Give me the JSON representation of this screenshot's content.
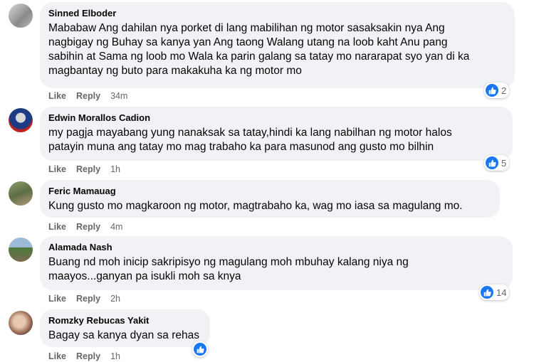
{
  "actions": {
    "like": "Like",
    "reply": "Reply"
  },
  "comments": [
    {
      "author": "Sinned Elboder",
      "lines": [
        "Mababaw Ang dahilan nya porket di lang mabilihan ng motor sasaksakin nya Ang",
        "nagbigay ng Buhay sa kanya yan Ang taong Walang utang na loob kaht Anu pang",
        "sabihin at Sama ng loob mo Wala ka parin galang sa tatay mo nararapat syo yan di ka",
        "magbantay ng buto para makakuha ka ng motor mo"
      ],
      "time": "34m",
      "reactions": "2"
    },
    {
      "author": "Edwin Morallos Cadion",
      "lines": [
        "my pagja mayabang yung nanaksak sa tatay,hindi ka lang nabilhan ng motor halos",
        "patayin muna ang tatay mo mag trabaho ka para masunod ang gusto mo bilhin"
      ],
      "time": "1h",
      "reactions": "5"
    },
    {
      "author": "Feric Mamauag",
      "lines": [
        "Kung gusto mo magkaroon ng motor, magtrabaho ka, wag mo iasa sa magulang mo."
      ],
      "time": "4m",
      "reactions": null
    },
    {
      "author": "Alamada Nash",
      "lines": [
        "Buang nd moh inicip sakripisyo ng magulang moh mbuhay kalang niya ng",
        "maayos...ganyan pa isukli moh sa knya"
      ],
      "time": "2h",
      "reactions": "14"
    },
    {
      "author": "Romzky Rebucas Yakit",
      "lines": [
        "Bagay sa kanya dyan sa rehas"
      ],
      "time": "1h",
      "reactions": ""
    }
  ]
}
